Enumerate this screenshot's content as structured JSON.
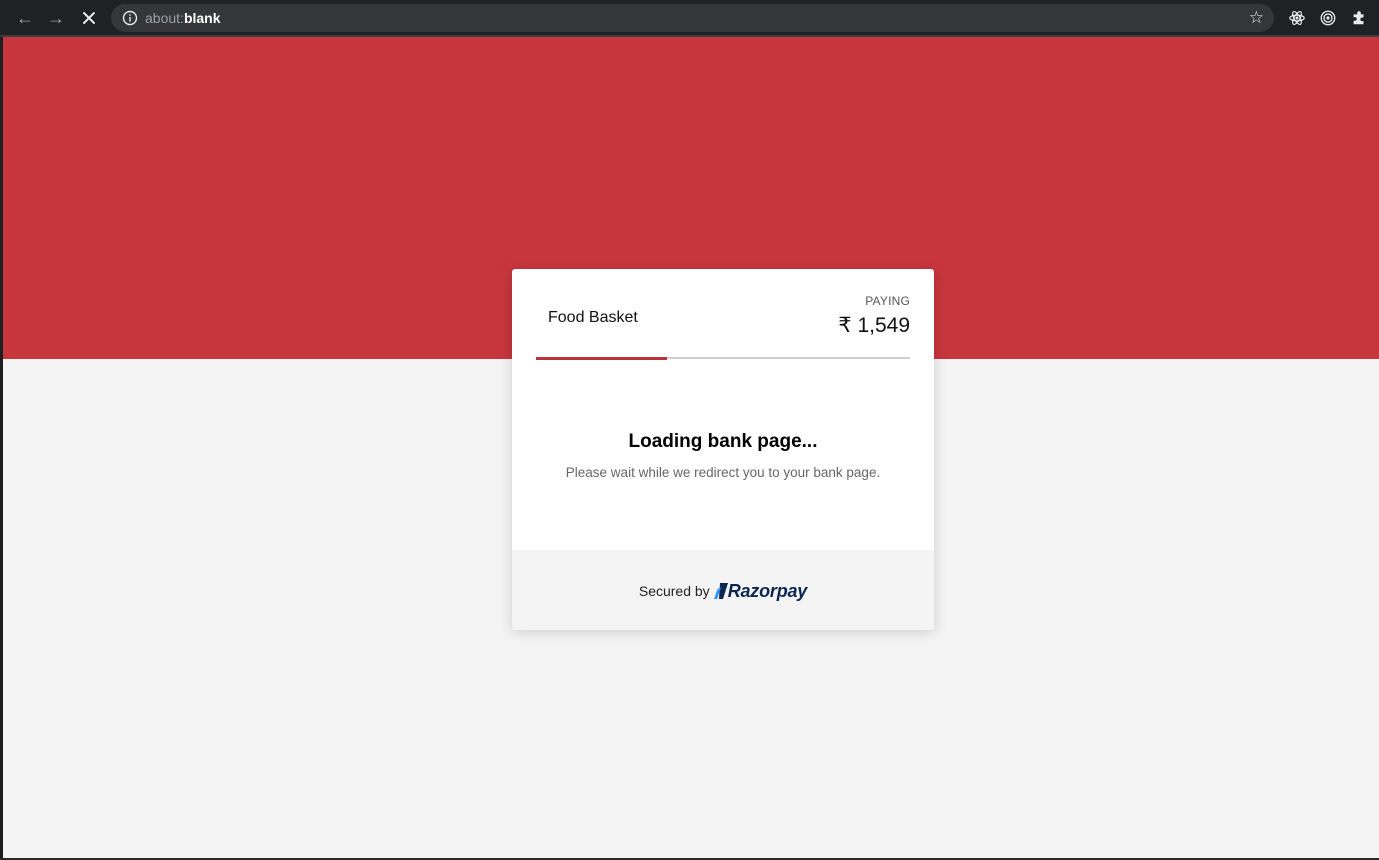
{
  "browser": {
    "url_scheme": "about:",
    "url_host": "blank",
    "icons": {
      "back": "arrow-left-icon",
      "forward": "arrow-right-icon",
      "stop": "close-icon",
      "info": "info-icon",
      "bookmark": "star-icon",
      "extensions": [
        "react-devtools-icon",
        "target-extension-icon",
        "puzzle-extensions-icon"
      ]
    }
  },
  "theme": {
    "brand_red": "#c8363d",
    "page_bg": "#f4f4f4",
    "razorpay_navy": "#0c2651",
    "razorpay_blue": "#3395ff"
  },
  "checkout": {
    "merchant_name": "Food Basket",
    "paying_label": "PAYING",
    "amount": "₹ 1,549",
    "progress_fraction": 0.35,
    "loading_title": "Loading bank page...",
    "loading_message": "Please wait while we redirect you to your bank page.",
    "footer": {
      "secured_by": "Secured by",
      "brand": "Razorpay"
    }
  }
}
